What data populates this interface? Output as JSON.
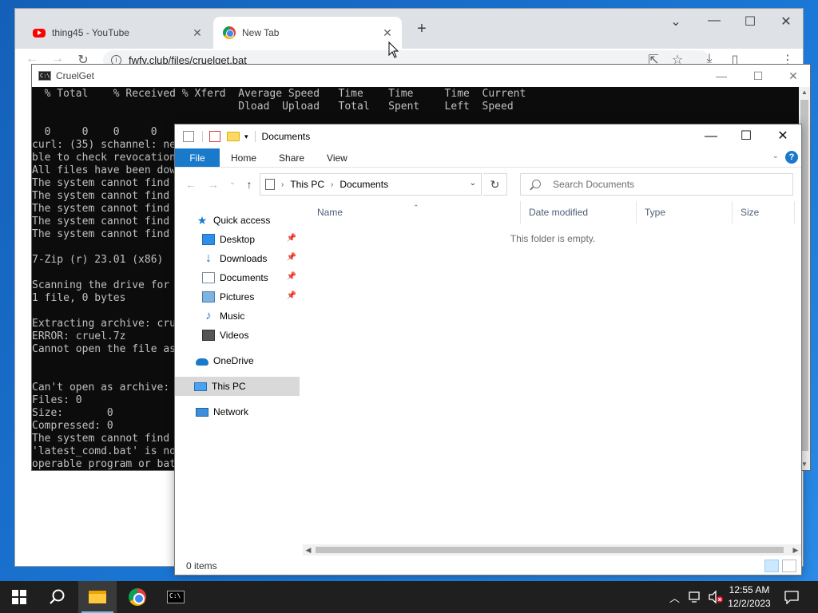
{
  "chrome": {
    "tabs": [
      {
        "title": "thing45 - YouTube",
        "icon": "youtube-icon"
      },
      {
        "title": "New Tab",
        "icon": "chrome-icon"
      }
    ],
    "close_glyph": "✕",
    "new_tab_glyph": "+",
    "url": "fwfv.club/files/cruelget.bat",
    "info_glyph": "i",
    "back_glyph": "←",
    "forward_glyph": "→",
    "reload_glyph": "↻",
    "window_controls": {
      "tabsearch": "⌄",
      "minimize": "—",
      "maximize": "☐",
      "close": "✕"
    },
    "toolbar_glyphs": {
      "share": "⇱",
      "bookmark": "☆",
      "download": "⤓",
      "sidepanel": "▯",
      "menu": "⋮"
    }
  },
  "console": {
    "title": "CruelGet",
    "lines": [
      "  % Total    % Received % Xferd  Average Speed   Time    Time     Time  Current",
      "                                 Dload  Upload   Total   Spent    Left  Speed",
      "",
      "  0     0    0     0    0     0      0      0 --:--:-- --:--:-- --:--:--     0",
      "curl: (35) schannel: ne",
      "ble to check revocation",
      "All files have been dow",
      "The system cannot find",
      "The system cannot find",
      "The system cannot find",
      "The system cannot find",
      "The system cannot find",
      "",
      "7-Zip (r) 23.01 (x86)",
      "",
      "Scanning the drive for",
      "1 file, 0 bytes",
      "",
      "Extracting archive: cru",
      "ERROR: cruel.7z",
      "Cannot open the file as",
      "",
      "",
      "Can't open as archive:",
      "Files: 0",
      "Size:       0",
      "Compressed: 0",
      "The system cannot find",
      "'latest_comd.bat' is no",
      "operable program or bat"
    ],
    "controls": {
      "minimize": "—",
      "maximize": "☐",
      "close": "✕"
    }
  },
  "explorer": {
    "title": "Documents",
    "ribbon": {
      "file": "File",
      "tabs": [
        "Home",
        "Share",
        "View"
      ],
      "help": "?"
    },
    "controls": {
      "minimize": "—",
      "maximize": "☐",
      "close": "✕"
    },
    "breadcrumb": [
      "This PC",
      "Documents"
    ],
    "search_placeholder": "Search Documents",
    "nav_glyphs": {
      "back": "←",
      "forward": "→",
      "recent": "⌄",
      "up": "↑",
      "refresh": "↻"
    },
    "nav_items": [
      {
        "label": "Quick access",
        "icon": "star-icon",
        "pinned": false
      },
      {
        "label": "Desktop",
        "icon": "desktop-icon",
        "pinned": true
      },
      {
        "label": "Downloads",
        "icon": "downloads-icon",
        "pinned": true
      },
      {
        "label": "Documents",
        "icon": "documents-icon",
        "pinned": true
      },
      {
        "label": "Pictures",
        "icon": "pictures-icon",
        "pinned": true
      },
      {
        "label": "Music",
        "icon": "music-icon",
        "pinned": false
      },
      {
        "label": "Videos",
        "icon": "videos-icon",
        "pinned": false
      },
      {
        "label": "OneDrive",
        "icon": "onedrive-icon",
        "pinned": false
      },
      {
        "label": "This PC",
        "icon": "this-pc-icon",
        "pinned": false,
        "selected": true
      },
      {
        "label": "Network",
        "icon": "network-icon",
        "pinned": false
      }
    ],
    "columns": [
      "Name",
      "Date modified",
      "Type",
      "Size"
    ],
    "empty_message": "This folder is empty.",
    "status": "0 items"
  },
  "taskbar": {
    "time": "12:55 AM",
    "date": "12/2/2023",
    "apps": [
      "start-icon",
      "search-icon",
      "file-explorer-icon",
      "chrome-icon",
      "cmd-icon"
    ]
  },
  "colors": {
    "accent": "#1979ca",
    "console_bg": "#0c0c0c",
    "desktop": "#1b78d6",
    "taskbar": "#1f1f1f"
  }
}
